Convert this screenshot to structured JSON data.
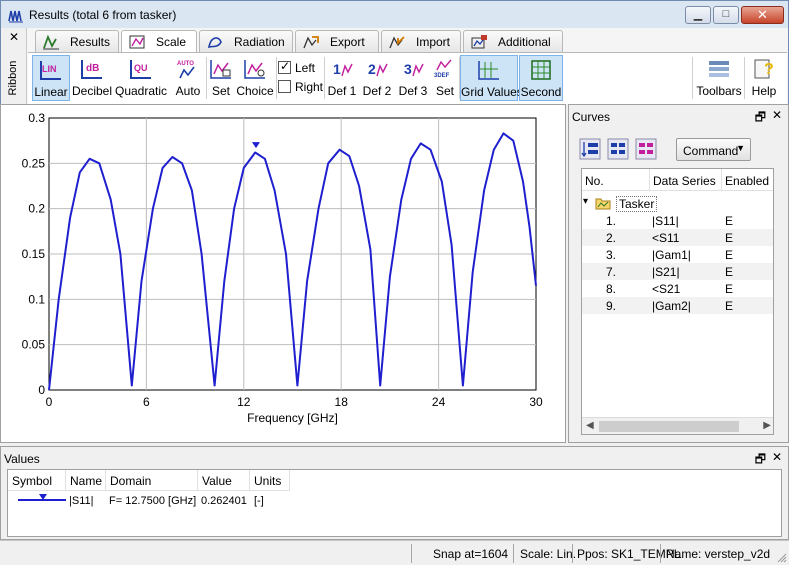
{
  "window": {
    "title": "Results (total 6 from tasker)",
    "controls": {
      "minimize": "▁",
      "maximize": "□",
      "close": "✕"
    }
  },
  "ribbon": {
    "side_close": "✕",
    "side_label": "Ribbon",
    "tabs": [
      {
        "label": "Results",
        "icon": "results-icon"
      },
      {
        "label": "Scale",
        "icon": "scale-icon",
        "active": true
      },
      {
        "label": "Radiation",
        "icon": "radiation-icon"
      },
      {
        "label": "Export",
        "icon": "export-icon"
      },
      {
        "label": "Import",
        "icon": "import-icon"
      },
      {
        "label": "Additional",
        "icon": "additional-icon"
      }
    ],
    "buttons": {
      "linear": {
        "label": "Linear",
        "glyph": "LIN"
      },
      "decibel": {
        "label": "Decibel",
        "glyph": "dB"
      },
      "quadratic": {
        "label": "Quadratic",
        "glyph": "QU"
      },
      "auto": {
        "label": "Auto",
        "glyph": "AUTO"
      },
      "set": {
        "label": "Set"
      },
      "choice": {
        "label": "Choice"
      },
      "left": {
        "label": "Left",
        "checked": true,
        "mark": "✓"
      },
      "right": {
        "label": "Right",
        "checked": false
      },
      "def1": {
        "label": "Def 1",
        "glyph": "1"
      },
      "def2": {
        "label": "Def 2",
        "glyph": "2"
      },
      "def3": {
        "label": "Def 3",
        "glyph": "3"
      },
      "defset": {
        "label": "Set",
        "glyph": "3DEF"
      },
      "grid_values": {
        "label": "Grid Values"
      },
      "second": {
        "label": "Second"
      },
      "toolbars": {
        "label": "Toolbars"
      },
      "help": {
        "label": "Help",
        "glyph": "?"
      }
    }
  },
  "chart_data": {
    "type": "line",
    "xlabel": "Frequency [GHz]",
    "ylabel": "",
    "xlim": [
      0,
      30
    ],
    "ylim": [
      0,
      0.3
    ],
    "xticks": [
      0,
      6,
      12,
      18,
      24,
      30
    ],
    "yticks": [
      0,
      0.05,
      0.1,
      0.15,
      0.2,
      0.25,
      0.3
    ],
    "xtick_labels": [
      "0",
      "6",
      "12",
      "18",
      "24",
      "30"
    ],
    "ytick_labels": [
      "0",
      "0.05",
      "0.1",
      "0.15",
      "0.2",
      "0.25",
      "0.3"
    ],
    "grid": true,
    "color": "#1f1fcf",
    "series": [
      {
        "points": [
          [
            0,
            0
          ],
          [
            0.6,
            0.1
          ],
          [
            1.3,
            0.19
          ],
          [
            1.9,
            0.24
          ],
          [
            2.5,
            0.255
          ],
          [
            3.1,
            0.25
          ],
          [
            3.8,
            0.21
          ],
          [
            4.4,
            0.15
          ],
          [
            5.1,
            0.005
          ],
          [
            5.7,
            0.12
          ],
          [
            6.4,
            0.2
          ],
          [
            7.0,
            0.245
          ],
          [
            7.6,
            0.257
          ],
          [
            8.2,
            0.25
          ],
          [
            8.8,
            0.22
          ],
          [
            9.4,
            0.15
          ],
          [
            10.2,
            0.005
          ],
          [
            10.8,
            0.12
          ],
          [
            11.4,
            0.2
          ],
          [
            12.0,
            0.245
          ],
          [
            12.7,
            0.262
          ],
          [
            13.3,
            0.255
          ],
          [
            13.9,
            0.22
          ],
          [
            14.6,
            0.15
          ],
          [
            15.3,
            0.005
          ],
          [
            15.9,
            0.12
          ],
          [
            16.6,
            0.2
          ],
          [
            17.2,
            0.25
          ],
          [
            17.9,
            0.265
          ],
          [
            18.5,
            0.258
          ],
          [
            19.1,
            0.225
          ],
          [
            19.8,
            0.155
          ],
          [
            20.4,
            0.005
          ],
          [
            21.0,
            0.125
          ],
          [
            21.7,
            0.21
          ],
          [
            22.3,
            0.255
          ],
          [
            22.9,
            0.272
          ],
          [
            23.5,
            0.265
          ],
          [
            24.2,
            0.23
          ],
          [
            24.8,
            0.16
          ],
          [
            25.5,
            0.005
          ],
          [
            26.1,
            0.13
          ],
          [
            26.8,
            0.22
          ],
          [
            27.4,
            0.265
          ],
          [
            28.0,
            0.283
          ],
          [
            28.6,
            0.275
          ],
          [
            29.2,
            0.23
          ],
          [
            29.6,
            0.18
          ],
          [
            30,
            0.115
          ]
        ]
      }
    ],
    "marker": {
      "x": 12.75,
      "y": 0.262401
    }
  },
  "curves": {
    "title": "Curves",
    "pin": "🗗",
    "close": "✕",
    "command_label": "Command",
    "columns": [
      "No.",
      "Data Series",
      "Enabled"
    ],
    "group": "Tasker",
    "rows": [
      {
        "no": "1.",
        "name": "|S11|",
        "enabled": "E"
      },
      {
        "no": "2.",
        "name": "<S11",
        "enabled": "E"
      },
      {
        "no": "3.",
        "name": "|Gam1|",
        "enabled": "E"
      },
      {
        "no": "7.",
        "name": "|S21|",
        "enabled": "E"
      },
      {
        "no": "8.",
        "name": "<S21",
        "enabled": "E"
      },
      {
        "no": "9.",
        "name": "|Gam2|",
        "enabled": "E"
      }
    ]
  },
  "values": {
    "title": "Values",
    "columns": [
      "Symbol",
      "Name",
      "Domain",
      "Value",
      "Units"
    ],
    "row": {
      "name": "|S11|",
      "domain": "F= 12.7500 [GHz]",
      "value": "0.262401",
      "units": "[-]"
    }
  },
  "status": {
    "snap": "Snap at=1604",
    "scale": "Scale: Lin.",
    "ppos": "Ppos: SK1_TEMPL",
    "name": "Name: verstep_v2d"
  }
}
